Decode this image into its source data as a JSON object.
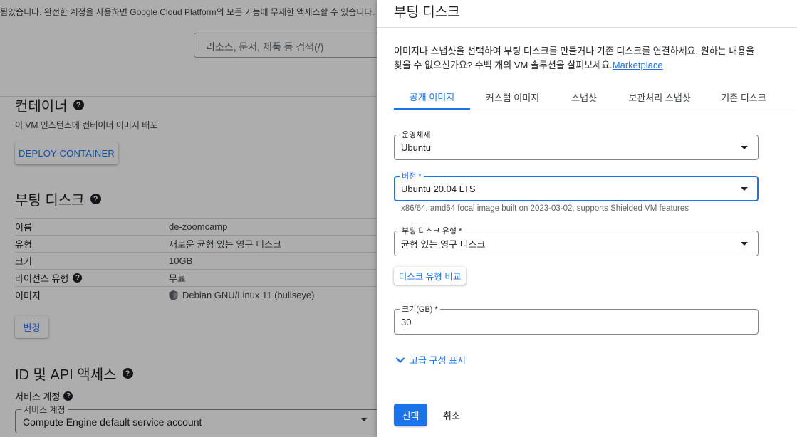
{
  "background": {
    "banner_text": "됨았습니다. 완전한 계정을 사용하면 Google Cloud Platform의 모든 기능에 무제한 액세스할 수 있습니다.",
    "search_placeholder": "리소스, 문서, 제품 등 검색(/)",
    "container_section": {
      "title": "컨테이너",
      "subtitle": "이 VM 인스턴스에 컨테이너 이미지 배포",
      "deploy_label": "DEPLOY CONTAINER"
    },
    "boot_disk_section": {
      "title": "부팅 디스크",
      "rows": [
        {
          "key": "이름",
          "value": "de-zoomcamp"
        },
        {
          "key": "유형",
          "value": "새로운 균형 있는 영구 디스크"
        },
        {
          "key": "크기",
          "value": "10GB"
        },
        {
          "key": "라이선스 유형",
          "value": "무료"
        },
        {
          "key": "이미지",
          "value": "Debian GNU/Linux 11 (bullseye)"
        }
      ],
      "change_label": "변경"
    },
    "id_api_section": {
      "title": "ID 및 API 액세스",
      "service_account_label": "서비스 계정",
      "service_account_field_label": "서비스 계정",
      "service_account_value": "Compute Engine default service account"
    }
  },
  "panel": {
    "title": "부팅 디스크",
    "description": "이미지나 스냅샷을 선택하여 부팅 디스크를 만들거나 기존 디스크를 연결하세요. 원하는 내용을 찾을 수 없으신가요? 수백 개의 VM 솔루션을 살펴보세요.",
    "marketplace_link": "Marketplace",
    "tabs": [
      {
        "label": "공개 이미지",
        "active": true
      },
      {
        "label": "커스텀 이미지",
        "active": false
      },
      {
        "label": "스냅샷",
        "active": false
      },
      {
        "label": "보관처리 스냅샷",
        "active": false
      },
      {
        "label": "기존 디스크",
        "active": false
      }
    ],
    "os_field": {
      "label": "운영체제",
      "value": "Ubuntu"
    },
    "version_field": {
      "label": "버전 *",
      "value": "Ubuntu 20.04 LTS",
      "hint": "x86/64, amd64 focal image built on 2023-03-02, supports Shielded VM features"
    },
    "disk_type_field": {
      "label": "부팅 디스크 유형 *",
      "value": "균형 있는 영구 디스크"
    },
    "compare_label": "디스크 유형 비교",
    "size_field": {
      "label": "크기(GB) *",
      "value": "30"
    },
    "advanced_label": "고급 구성 표시",
    "select_label": "선택",
    "cancel_label": "취소"
  },
  "colors": {
    "accent": "#1a73e8",
    "scrim": "rgba(0,0,0,0.32)"
  }
}
